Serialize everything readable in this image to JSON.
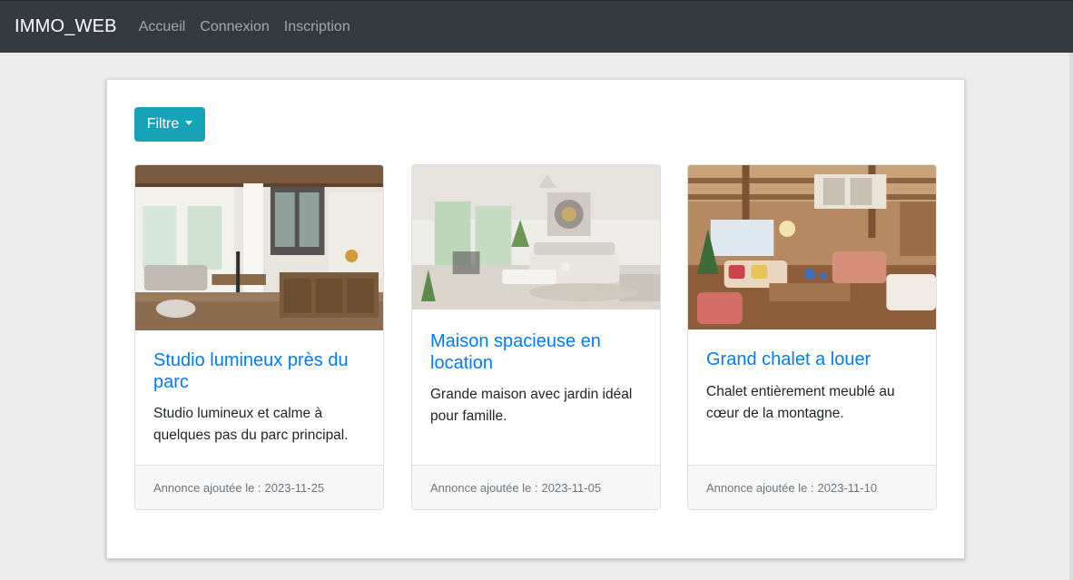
{
  "navbar": {
    "brand": "IMMO_WEB",
    "links": [
      "Accueil",
      "Connexion",
      "Inscription"
    ]
  },
  "filter": {
    "label": "Filtre"
  },
  "listings": [
    {
      "title": "Studio lumineux près du parc",
      "description": "Studio lumineux et calme à quelques pas du parc principal.",
      "footer_label": "Annonce ajoutée le :",
      "date": "2023-11-25"
    },
    {
      "title": "Maison spacieuse en location",
      "description": "Grande maison avec jardin idéal pour famille.",
      "footer_label": "Annonce ajoutée le :",
      "date": "2023-11-05"
    },
    {
      "title": "Grand chalet a louer",
      "description": "Chalet entièrement meublé au cœur de la montagne.",
      "footer_label": "Annonce ajoutée le :",
      "date": "2023-11-10"
    }
  ],
  "colors": {
    "navbar_bg": "#343a40",
    "accent_button": "#17a2b8",
    "link": "#007bff"
  },
  "icons": [
    "caret-down-icon"
  ]
}
